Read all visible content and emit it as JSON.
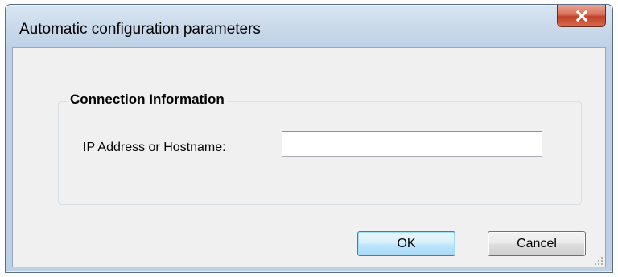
{
  "window": {
    "title": "Automatic configuration parameters",
    "close_icon": "close-x-icon"
  },
  "group": {
    "legend": "Connection Information"
  },
  "form": {
    "ip_label": "IP Address or Hostname:",
    "ip_value": "",
    "ip_placeholder": ""
  },
  "buttons": {
    "ok_label": "OK",
    "cancel_label": "Cancel"
  },
  "colors": {
    "titlebar": "#c9d9ea",
    "close_button": "#c0402b",
    "client_background": "#f0f0f0",
    "ok_button": "#bee6fd"
  },
  "icons": {
    "resize_grip": "resize-grip-icon"
  }
}
